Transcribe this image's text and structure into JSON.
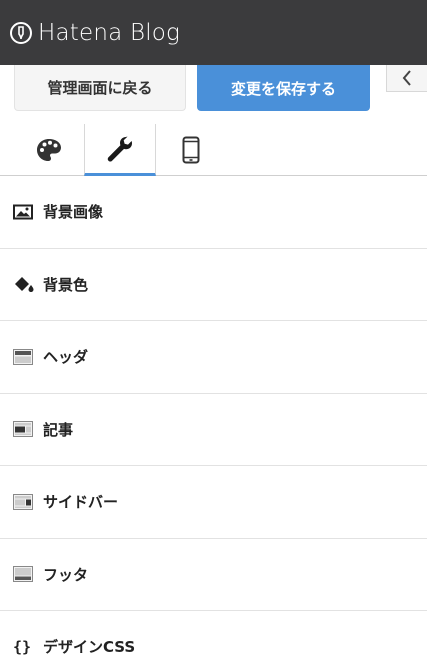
{
  "header": {
    "brand": "Hatena Blog"
  },
  "toolbar": {
    "back_label": "管理画面に戻る",
    "save_label": "変更を保存する",
    "collapse_icon": "chevron-left-icon"
  },
  "tabs": [
    {
      "icon": "palette-icon",
      "active": false
    },
    {
      "icon": "wrench-icon",
      "active": true
    },
    {
      "icon": "smartphone-icon",
      "active": false
    }
  ],
  "menu": {
    "items": [
      {
        "label": "背景画像",
        "icon": "image-icon"
      },
      {
        "label": "背景色",
        "icon": "paint-bucket-icon"
      },
      {
        "label": "ヘッダ",
        "icon": "layout-header-icon"
      },
      {
        "label": "記事",
        "icon": "layout-article-icon"
      },
      {
        "label": "サイドバー",
        "icon": "layout-sidebar-icon"
      },
      {
        "label": "フッタ",
        "icon": "layout-footer-icon"
      },
      {
        "label": "デザインCSS",
        "icon": "braces-icon",
        "icon_text": "{}"
      }
    ]
  },
  "colors": {
    "accent": "#4a90d9",
    "topbar": "#3b3b3d"
  }
}
